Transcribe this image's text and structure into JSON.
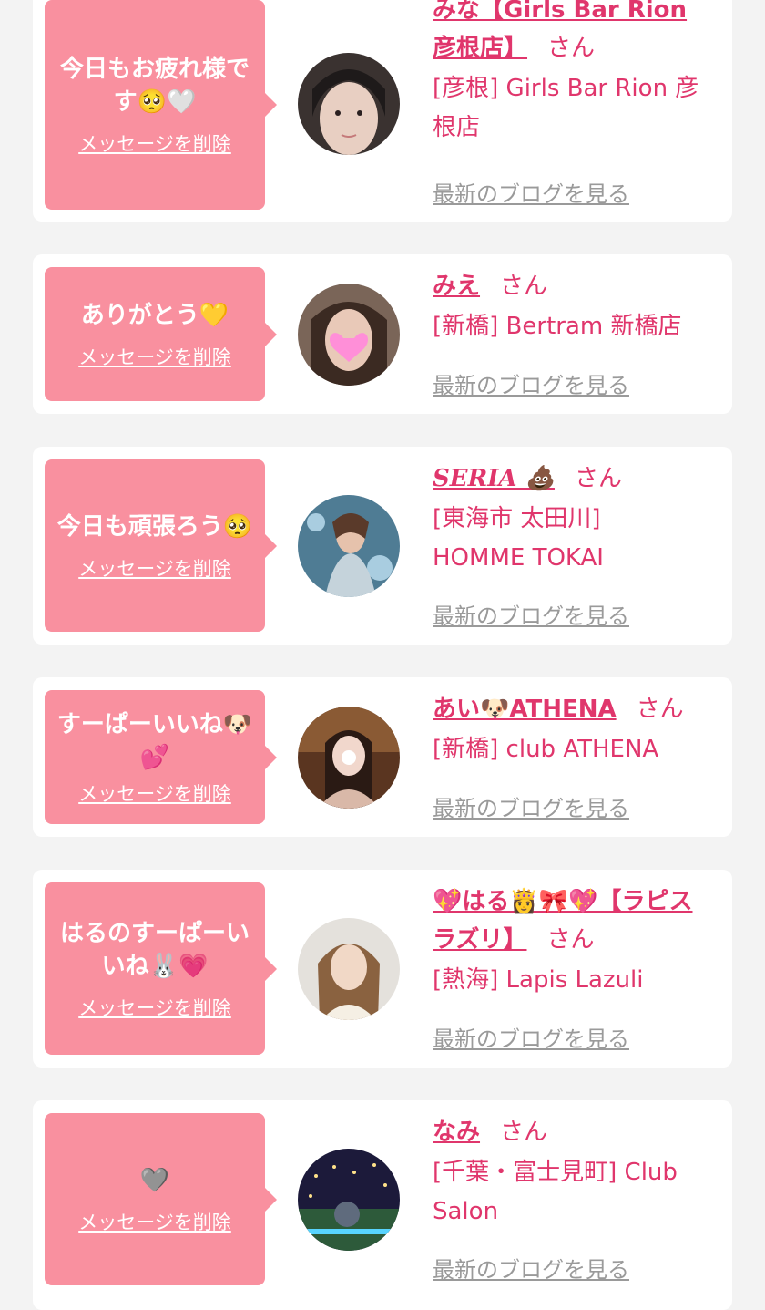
{
  "messages": [
    {
      "bubble_text": "今日もお疲れ様です🥺🤍",
      "delete_label": "メッセージを削除",
      "name": "みな【Girls Bar Rion 彦根店】",
      "suffix": "さん",
      "shop": "[彦根] Girls Bar Rion 彦根店",
      "blog_link": "最新のブログを見る"
    },
    {
      "bubble_text": "ありがとう💛",
      "delete_label": "メッセージを削除",
      "name": "みえ",
      "suffix": "さん",
      "shop": "[新橋] Bertram 新橋店",
      "blog_link": "最新のブログを見る"
    },
    {
      "bubble_text": "今日も頑張ろう🥺",
      "delete_label": "メッセージを削除",
      "name": "SERIA 💩",
      "suffix": "さん",
      "shop": "[東海市 太田川] HOMME TOKAI",
      "blog_link": "最新のブログを見る"
    },
    {
      "bubble_text": "すーぱーいいね🐶💕",
      "delete_label": "メッセージを削除",
      "name": "あい🐶ATHENA",
      "suffix": "さん",
      "shop": "[新橋] club ATHENA",
      "blog_link": "最新のブログを見る"
    },
    {
      "bubble_text": "はるのすーぱーいいね🐰💗",
      "delete_label": "メッセージを削除",
      "name": "💖はる👸🎀💖【ラピスラズリ】",
      "suffix": "さん",
      "shop": "[熱海] Lapis Lazuli",
      "blog_link": "最新のブログを見る"
    },
    {
      "bubble_text": "🩶",
      "delete_label": "メッセージを削除",
      "name": "なみ",
      "suffix": "さん",
      "shop": "[千葉・富士見町] Club Salon",
      "blog_link": "最新のブログを見る"
    }
  ],
  "colors": {
    "page_bg": "#f3f3f3",
    "card_bg": "#ffffff",
    "bubble_bg": "#f9909f",
    "accent_text": "#e0366c",
    "blog_link": "#9a9a9a"
  }
}
